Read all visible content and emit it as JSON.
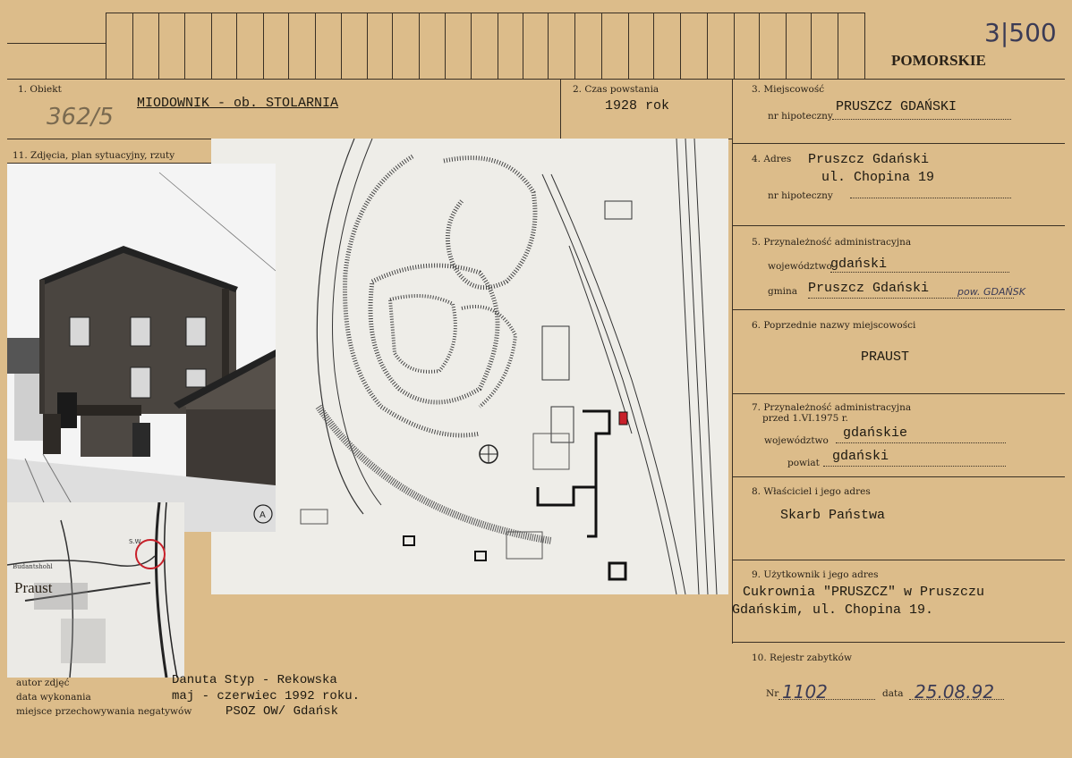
{
  "header": {
    "region": "POMORSKIE",
    "handwritten_corner": "3|500"
  },
  "field1": {
    "label": "1. Obiekt",
    "value": "MIODOWNIK - ob. STOLARNIA",
    "handwritten": "362/5"
  },
  "field2": {
    "label": "2. Czas powstania",
    "value": "1928 rok"
  },
  "field3": {
    "label": "3. Miejscowość",
    "value": "PRUSZCZ GDAŃSKI",
    "sub_label": "nr hipoteczny"
  },
  "field4": {
    "label": "4. Adres",
    "value_line1": "Pruszcz Gdański",
    "value_line2": "ul. Chopina 19",
    "sub_label": "nr hipoteczny"
  },
  "field5": {
    "label": "5. Przynależność administracyjna",
    "wojewodztwo_label": "województwo",
    "wojewodztwo_value": "gdański",
    "gmina_label": "gmina",
    "gmina_value": "Pruszcz Gdański",
    "gmina_note": "pow. GDAŃSK"
  },
  "field6": {
    "label": "6. Poprzednie nazwy miejscowości",
    "value": "PRAUST"
  },
  "field7": {
    "label_line1": "7. Przynależność administracyjna",
    "label_line2": "przed 1.VI.1975 r.",
    "wojewodztwo_label": "województwo",
    "wojewodztwo_value": "gdańskie",
    "powiat_label": "powiat",
    "powiat_value": "gdański"
  },
  "field8": {
    "label": "8. Właściciel i jego adres",
    "value": "Skarb Państwa"
  },
  "field9": {
    "label": "9. Użytkownik i jego adres",
    "value_line1": "Cukrownia \"PRUSZCZ\" w Pruszczu",
    "value_line2": "Gdańskim, ul. Chopina 19."
  },
  "field10": {
    "label": "10. Rejestr zabytków",
    "nr_label": "Nr",
    "nr_value": "1102",
    "data_label": "data",
    "data_value": "25.08.92"
  },
  "field11": {
    "label": "11. Zdjęcia, plan sytuacyjny, rzuty"
  },
  "footer": {
    "author_label": "autor zdjęć",
    "author_value": "Danuta Styp - Rekowska",
    "date_label": "data wykonania",
    "date_value": "maj - czerwiec 1992 roku.",
    "storage_label": "miejsce przechowywania negatywów",
    "storage_value": "PSOZ OW/ Gdańsk"
  },
  "inset_map": {
    "town_label": "Praust"
  },
  "site_plan": {
    "marker": "A"
  },
  "colors": {
    "card": "#dcbc8a",
    "ink": "#2a2218",
    "red_marker": "#c8202a"
  }
}
